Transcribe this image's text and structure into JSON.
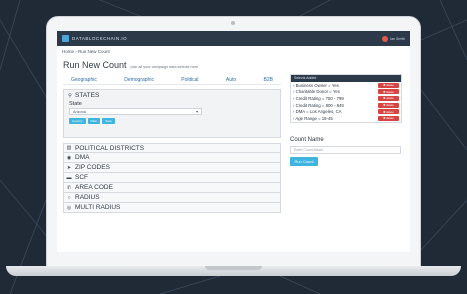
{
  "app": {
    "brand": "DATABLOCKCHAIN.IO",
    "user": "Ian Smith"
  },
  "breadcrumb": "Home › Run New Count",
  "page": {
    "title": "Run New Count",
    "subtitle": "pick all your campaign data selects here"
  },
  "tabs": [
    "Geographic",
    "Demographic",
    "Political",
    "Auto",
    "B2B"
  ],
  "states": {
    "heading": "STATES",
    "label": "State",
    "selected": "Arizona",
    "buttons": [
      "Country",
      "Filter",
      "Save"
    ]
  },
  "sections": [
    {
      "label": "POLITICAL DISTRICTS",
      "icon": "columns-icon",
      "glyph": "▥"
    },
    {
      "label": "DMA",
      "icon": "target-icon",
      "glyph": "◉"
    },
    {
      "label": "ZIP CODES",
      "icon": "location-arrow-icon",
      "glyph": "➤"
    },
    {
      "label": "SCF",
      "icon": "envelope-icon",
      "glyph": "▬"
    },
    {
      "label": "AREA CODE",
      "icon": "phone-icon",
      "glyph": "✆"
    },
    {
      "label": "RADIUS",
      "icon": "circle-icon",
      "glyph": "○"
    },
    {
      "label": "MULTI RADIUS",
      "icon": "multi-circle-icon",
      "glyph": "◎"
    }
  ],
  "selected": {
    "heading": "Selects Added",
    "delete_label": "✖ delete",
    "items": [
      "› Business Owner = Yes",
      "› Charitable Donor = Yes",
      "› Credit Rating = 750 - 799",
      "› Credit Rating = 800 - 849",
      "› DMA = Los Angeles, CA",
      "› Age Range = 18-45"
    ]
  },
  "count": {
    "label": "Count Name",
    "placeholder": "Enter Count Name",
    "run_label": "Run Count"
  },
  "colors": {
    "header": "#2b3949",
    "accent": "#3fb4de",
    "danger": "#d64541",
    "background": "#1f2a36"
  }
}
